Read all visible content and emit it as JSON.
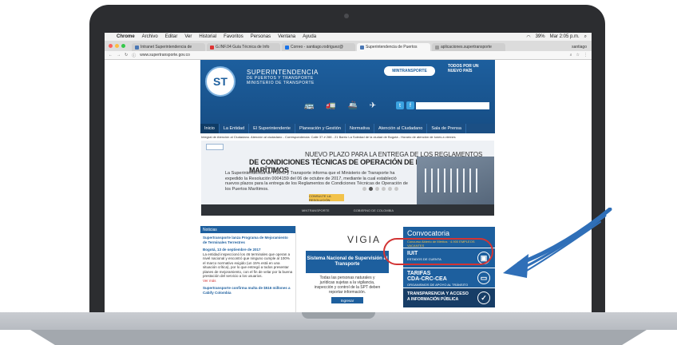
{
  "menubar": {
    "apple": "",
    "app": "Chrome",
    "menus": [
      "Archivo",
      "Editar",
      "Ver",
      "Historial",
      "Favoritos",
      "Personas",
      "Ventana",
      "Ayuda"
    ],
    "battery": "39%",
    "clock": "Mar 2:05 p.m."
  },
  "tabs": [
    {
      "label": "Intranet Superintendencia de"
    },
    {
      "label": "G.INF.04 Guía Técnica de Info"
    },
    {
      "label": "Correo - santiago.rodriguez@"
    },
    {
      "label": "Superintendencia de Puertos"
    },
    {
      "label": "aplicaciones.supertransporte"
    }
  ],
  "user": "santiago",
  "address": {
    "url": "www.supertransporte.gov.co"
  },
  "site": {
    "logo": "ST",
    "name1": "SUPERINTENDENCIA",
    "name2": "DE PUERTOS Y TRANSPORTE",
    "name3": "MINISTERIO DE TRANSPORTE",
    "mintransporte": "MINTRANSPORTE",
    "todos1": "TODOS POR UN",
    "todos2": "NUEVO PAÍS",
    "transport_glyphs": "🚌 🚛 🚢 ✈",
    "facebook": "f",
    "twitter": "t"
  },
  "nav": [
    "Inicio",
    "La Entidad",
    "El Superintendente",
    "Planeación y Gestión",
    "Normativa",
    "Atención al Ciudadano",
    "Sala de Prensa"
  ],
  "info_line": "Integral de Atención al Ciudadano. Atención al ciudadano - Correspondencia: Calle 37 # 288 - 21 Barrio La Soledad de la ciudad de Bogotá - Horario de atención de lunes a viernes",
  "banner": {
    "title1": "NUEVO PLAZO PARA LA ENTREGA DE LOS REGLAMENTOS",
    "title2": "DE CONDICIONES TÉCNICAS DE OPERACIÓN DE LOS PUERTOS MARÍTIMOS",
    "body": "La Superintendencia de Puerto y Transporte informa que el Ministerio de Transporte ha expedido la Resolución 0004159 del 06 de octubre de 2017, mediante la cual estableció nuevos plazos para la entrega de los Reglamentos de Condiciones Técnicas de Operación de los Puertos Marítimos.",
    "button": "CONSULTE LA RESOLUCIÓN",
    "footer_left": "MINTRANSPORTE",
    "footer_right": "GOBIERNO DE COLOMBIA"
  },
  "noticias": {
    "header": "Noticias",
    "item1_title": "Supertransporte lanza Programa de Mejoramiento de Terminales Terrestres",
    "item1_date": "Bogotá, 13 de septiembre de 2017",
    "item1_body": "La entidad inspeccionó los 46 terminales que operan a nivel nacional y encontró que ninguno cumple al 100% el marco normativo exigido (un 15% está en una situación crítica), por lo que entregó a todos presentar planes de mejoramiento, con el fin de velar por la buena prestación del servicio a los usuarios.",
    "item1_more": "Ver más",
    "item2_title": "Supertransporte confirma multa de $516 millones a Cabify Colombia"
  },
  "vigia": {
    "logo": "VIGIA",
    "title": "Sistema Nacional de Supervisión al Transporte",
    "body": "Todas las personas naturales y jurídicas sujetas a la vigilancia, inspección y control de la SPT deben reportar información.",
    "button": "Ingresar"
  },
  "right": {
    "conv_title": "Convocatoria",
    "conv_sub": "Concurso Abierto de Méritos · 4.900 EMPLEOS VACANTES",
    "iuit_title": "IUIT",
    "iuit_sub": "ESTADOS DE CUENTA",
    "tarifas_title": "TARIFAS",
    "tarifas_line2": "CDA-CRC-CEA",
    "tarifas_sub": "ORGANISMOS DE APOYO AL TRÁNSITO",
    "transp_title": "TRANSPARENCIA Y ACCESO",
    "transp_line2": "A INFORMACIÓN PÚBLICA"
  },
  "colors": {
    "brand_blue": "#1d5f9e",
    "nav_blue": "#1b4f84",
    "highlight_red": "#d23434",
    "arrow_blue": "#2f6fb8"
  }
}
